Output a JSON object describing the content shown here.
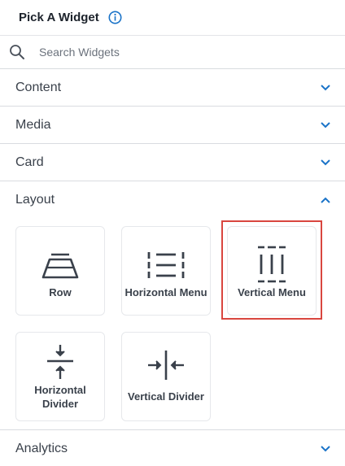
{
  "header": {
    "title": "Pick A Widget",
    "info_icon": "info-circle-icon"
  },
  "search": {
    "placeholder": "Search Widgets",
    "value": ""
  },
  "sections": [
    {
      "label": "Content",
      "expanded": false
    },
    {
      "label": "Media",
      "expanded": false
    },
    {
      "label": "Card",
      "expanded": false
    },
    {
      "label": "Layout",
      "expanded": true
    }
  ],
  "layout_widgets": [
    {
      "label": "Row",
      "icon": "row-icon"
    },
    {
      "label": "Horizontal Menu",
      "icon": "horizontal-menu-icon"
    },
    {
      "label": "Vertical Menu",
      "icon": "vertical-menu-icon",
      "highlighted": true
    },
    {
      "label": "Horizontal Divider",
      "icon": "horizontal-divider-icon"
    },
    {
      "label": "Vertical Divider",
      "icon": "vertical-divider-icon"
    }
  ],
  "footer_section": {
    "label": "Analytics",
    "expanded": false
  },
  "colors": {
    "accent": "#1a73c8",
    "highlight": "#d9463f",
    "icon": "#3a414b"
  }
}
